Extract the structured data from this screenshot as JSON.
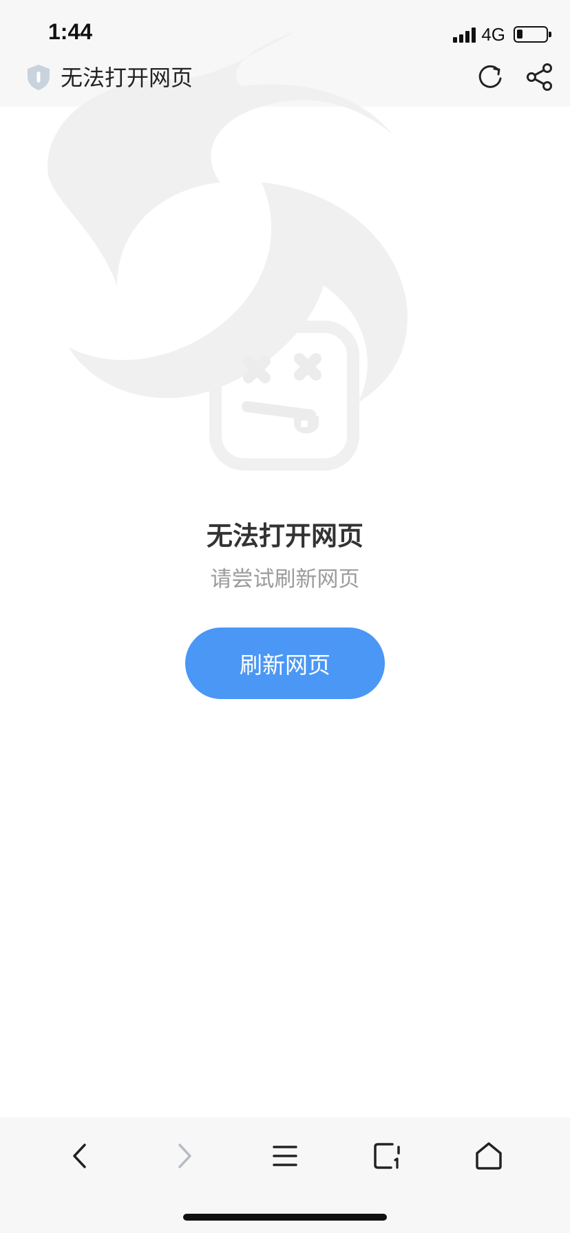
{
  "status_bar": {
    "time": "1:44",
    "network": "4G",
    "signal_bars": 4,
    "battery_level": 0.2
  },
  "header": {
    "title": "无法打开网页",
    "icons": [
      "shield-icon",
      "refresh-icon",
      "share-icon"
    ]
  },
  "error": {
    "title": "无法打开网页",
    "subtitle": "请尝试刷新网页",
    "button_label": "刷新网页",
    "icon": "dead-face-icon"
  },
  "bottom_nav": {
    "items": [
      "back-icon",
      "forward-icon",
      "menu-icon",
      "tabs-icon",
      "home-icon"
    ]
  },
  "colors": {
    "accent": "#4a97f5",
    "title": "#333333",
    "subtitle": "#9b9b9b",
    "bar_bg": "#f7f7f7",
    "disabled": "#b8bcc4"
  }
}
